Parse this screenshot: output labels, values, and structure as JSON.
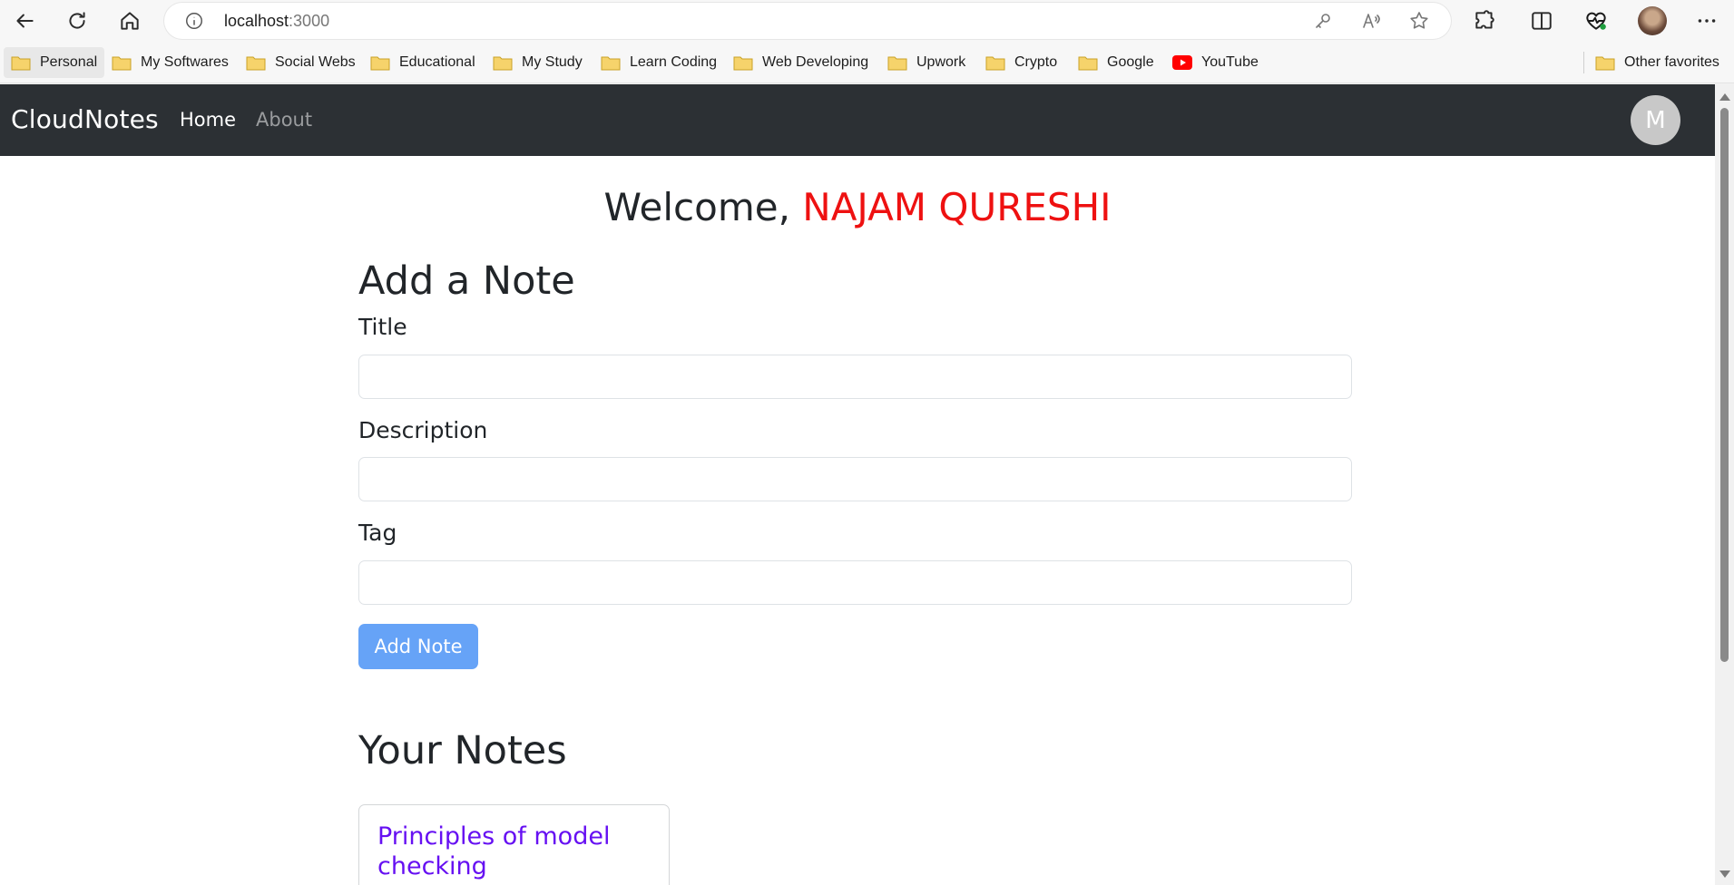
{
  "browser": {
    "url_host": "localhost",
    "url_port": ":3000",
    "icons": {
      "back": "back-arrow-icon",
      "refresh": "refresh-icon",
      "home": "home-icon",
      "info": "info-icon",
      "key": "key-icon",
      "read_aloud": "read-aloud-icon",
      "favorite": "star-icon",
      "extensions": "puzzle-icon",
      "split": "split-screen-icon",
      "health": "heart-pulse-icon",
      "more": "more-icon"
    }
  },
  "bookmarks": {
    "items": [
      {
        "label": "Personal"
      },
      {
        "label": "My Softwares"
      },
      {
        "label": "Social Webs"
      },
      {
        "label": "Educational"
      },
      {
        "label": "My Study"
      },
      {
        "label": "Learn Coding"
      },
      {
        "label": "Web Developing"
      },
      {
        "label": "Upwork"
      },
      {
        "label": "Crypto"
      },
      {
        "label": "Google"
      },
      {
        "label": "YouTube"
      }
    ],
    "other": "Other favorites"
  },
  "navbar": {
    "brand": "CloudNotes",
    "home": "Home",
    "about": "About",
    "avatar_initial": "M"
  },
  "welcome": {
    "prefix": "Welcome, ",
    "name": "NAJAM QURESHI"
  },
  "add_note": {
    "heading": "Add a Note",
    "title_label": "Title",
    "title_value": "",
    "description_label": "Description",
    "description_value": "",
    "tag_label": "Tag",
    "tag_value": "",
    "button": "Add Note"
  },
  "notes": {
    "heading": "Your Notes",
    "items": [
      {
        "title": "Principles of model checking"
      }
    ]
  },
  "colors": {
    "navbar_bg": "#2c3034",
    "welcome_name": "#ee1111",
    "button_bg": "#66a3f7",
    "note_title": "#6610f2"
  }
}
